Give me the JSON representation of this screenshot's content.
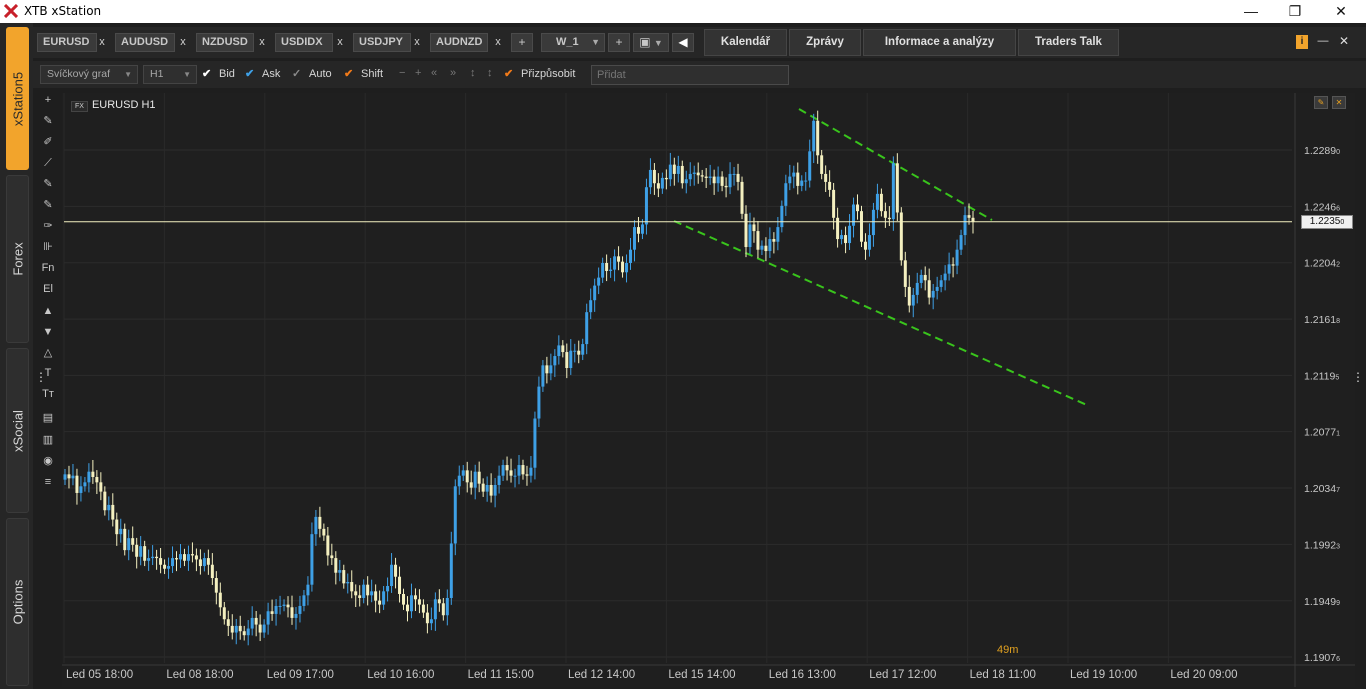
{
  "window": {
    "title": "XTB xStation",
    "minimize": "—",
    "restore": "❐",
    "close": "✕"
  },
  "rail": {
    "tabs": [
      "xStation5",
      "Forex",
      "xSocial",
      "Options"
    ]
  },
  "symbol_tabs": [
    {
      "label": "EURUSD",
      "close": "x"
    },
    {
      "label": "AUDUSD",
      "close": "x"
    },
    {
      "label": "NZDUSD",
      "close": "x"
    },
    {
      "label": "USDIDX",
      "close": "x"
    },
    {
      "label": "USDJPY",
      "close": "x"
    },
    {
      "label": "AUDNZD",
      "close": "x"
    }
  ],
  "tabbar": {
    "add": "+",
    "workspace": "W_1",
    "workspace_add": "+",
    "layout": "▣",
    "back": "◀"
  },
  "nav": [
    "Kalendář",
    "Zprávy",
    "Informace a analýzy",
    "Traders Talk"
  ],
  "right_icons": {
    "info": "i",
    "minimize": "—",
    "close": "✕"
  },
  "toolbar": {
    "chart_type": "Svíčkový graf",
    "timeframe": "H1",
    "checks": [
      {
        "label": "Bid",
        "on": true,
        "color": "#ffffff"
      },
      {
        "label": "Ask",
        "on": true,
        "color": "#3ea0e6"
      },
      {
        "label": "Auto",
        "on": false,
        "color": "#9a9a9a"
      },
      {
        "label": "Shift",
        "on": true,
        "color": "#f07a1a"
      }
    ],
    "fit_label": "Přizpůsobit",
    "add_placeholder": "Přidat"
  },
  "draw_tools": [
    "+",
    "✎",
    "✐",
    "⟋",
    "✎",
    "✎",
    "✑",
    "⊪",
    "Fn",
    "El",
    "▲",
    "▼",
    "△",
    "T",
    "Tт",
    "▤",
    "▥",
    "◉",
    "≡"
  ],
  "chart": {
    "instrument_badge": "FX",
    "instrument": "EURUSD H1",
    "countdown": "49m",
    "current_price": "1.2235",
    "current_price_sub": "0"
  },
  "colors": {
    "bull": "#3ea0e6",
    "bear": "#f4f0c0",
    "trend": "#39c41c",
    "price_line": "#f4f0c0"
  },
  "chart_data": {
    "type": "candlestick",
    "ylim": [
      1.1903,
      1.2325
    ],
    "y_ticks": [
      {
        "v": 1.2289,
        "main": "1.2289",
        "sub": "0"
      },
      {
        "v": 1.22466,
        "main": "1.2246",
        "sub": "6"
      },
      {
        "v": 1.22042,
        "main": "1.2204",
        "sub": "2"
      },
      {
        "v": 1.21618,
        "main": "1.2161",
        "sub": "8"
      },
      {
        "v": 1.21195,
        "main": "1.2119",
        "sub": "5"
      },
      {
        "v": 1.20771,
        "main": "1.2077",
        "sub": "1"
      },
      {
        "v": 1.20347,
        "main": "1.2034",
        "sub": "7"
      },
      {
        "v": 1.19923,
        "main": "1.1992",
        "sub": "3"
      },
      {
        "v": 1.19499,
        "main": "1.1949",
        "sub": "9"
      },
      {
        "v": 1.19076,
        "main": "1.1907",
        "sub": "6"
      }
    ],
    "x_ticks": [
      "Led 05 18:00",
      "Led 08 18:00",
      "Led 09 17:00",
      "Led 10 16:00",
      "Led 11 15:00",
      "Led 12 14:00",
      "Led 15 14:00",
      "Led 16 13:00",
      "Led 17 12:00",
      "Led 18 11:00",
      "Led 19 10:00",
      "Led 20 09:00"
    ],
    "closes": [
      1.2045,
      1.2042,
      1.2044,
      1.2031,
      1.2036,
      1.2039,
      1.2047,
      1.2043,
      1.2039,
      1.2032,
      1.2018,
      1.2022,
      1.2011,
      1.2,
      1.2004,
      1.1988,
      1.1997,
      1.1992,
      1.1983,
      1.1991,
      1.198,
      1.1982,
      1.1983,
      1.1982,
      1.1977,
      1.1974,
      1.1976,
      1.1982,
      1.1981,
      1.1985,
      1.198,
      1.1985,
      1.1984,
      1.1981,
      1.1976,
      1.1982,
      1.1977,
      1.1967,
      1.1956,
      1.1945,
      1.1936,
      1.1931,
      1.1926,
      1.1931,
      1.1927,
      1.1924,
      1.1929,
      1.1937,
      1.1932,
      1.1926,
      1.1932,
      1.1942,
      1.194,
      1.1946,
      1.1946,
      1.1947,
      1.1945,
      1.1937,
      1.194,
      1.1946,
      1.1954,
      1.1962,
      1.2,
      1.2013,
      1.2004,
      1.1999,
      1.1984,
      1.1982,
      1.1971,
      1.1973,
      1.1963,
      1.1964,
      1.1957,
      1.1954,
      1.1952,
      1.1962,
      1.1954,
      1.1957,
      1.195,
      1.1947,
      1.1957,
      1.1961,
      1.1977,
      1.1968,
      1.1955,
      1.1947,
      1.1942,
      1.1954,
      1.1951,
      1.1947,
      1.1941,
      1.1933,
      1.1936,
      1.1951,
      1.1948,
      1.1939,
      1.1952,
      1.1993,
      1.2036,
      1.2044,
      1.2048,
      1.2039,
      1.2035,
      1.2047,
      1.2038,
      1.2032,
      1.2037,
      1.2029,
      1.2037,
      1.2044,
      1.2052,
      1.2048,
      1.2044,
      1.2044,
      1.2052,
      1.2045,
      1.2044,
      1.205,
      1.2087,
      1.2111,
      1.2127,
      1.2121,
      1.2127,
      1.2134,
      1.2142,
      1.2137,
      1.2125,
      1.2138,
      1.2138,
      1.2135,
      1.2143,
      1.2167,
      1.2176,
      1.2187,
      1.2193,
      1.2204,
      1.2198,
      1.2199,
      1.2209,
      1.2205,
      1.2197,
      1.2204,
      1.2214,
      1.2231,
      1.2226,
      1.2233,
      1.2261,
      1.2274,
      1.2264,
      1.226,
      1.2268,
      1.2267,
      1.2278,
      1.2271,
      1.2277,
      1.2264,
      1.2267,
      1.2271,
      1.2272,
      1.227,
      1.2269,
      1.2268,
      1.2269,
      1.2264,
      1.2269,
      1.2262,
      1.2261,
      1.2271,
      1.2271,
      1.2265,
      1.2241,
      1.2216,
      1.2233,
      1.2228,
      1.2214,
      1.2217,
      1.2213,
      1.2222,
      1.222,
      1.2231,
      1.2247,
      1.2264,
      1.2269,
      1.2272,
      1.2262,
      1.2266,
      1.2266,
      1.2288,
      1.2311,
      1.2285,
      1.2271,
      1.2265,
      1.2259,
      1.2238,
      1.2222,
      1.2225,
      1.2219,
      1.2232,
      1.2248,
      1.2243,
      1.222,
      1.2214,
      1.2225,
      1.2244,
      1.2256,
      1.2243,
      1.2238,
      1.2237,
      1.2279,
      1.2242,
      1.2206,
      1.2186,
      1.2172,
      1.218,
      1.2189,
      1.2195,
      1.2191,
      1.2178,
      1.2183,
      1.2186,
      1.2191,
      1.2196,
      1.2203,
      1.2202,
      1.2214,
      1.2225,
      1.224,
      1.2238,
      1.2235
    ],
    "trendlines": [
      {
        "points": [
          [
            1.0,
            4.3
          ],
          [
            1.4,
            3.9
          ]
        ]
      },
      {
        "points": [
          [
            0.76,
            2.1
          ],
          [
            2.72,
            0.2
          ]
        ]
      }
    ]
  }
}
